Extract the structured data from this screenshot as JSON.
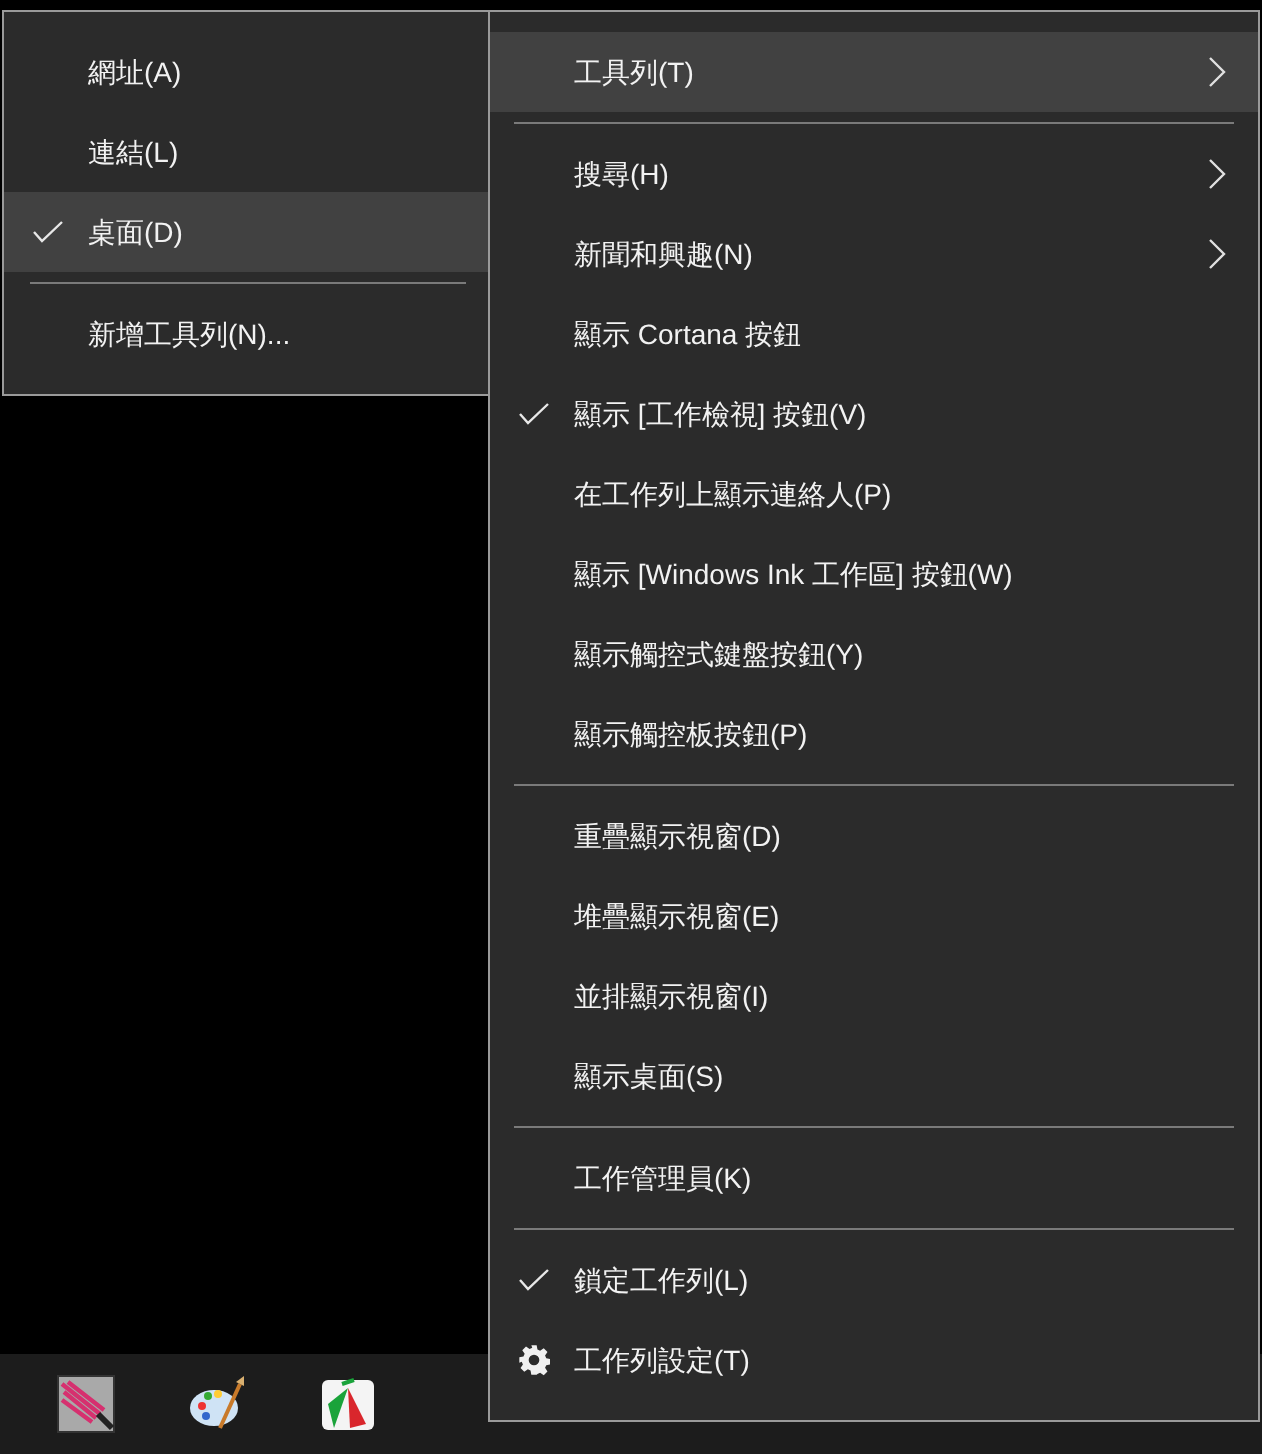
{
  "toolbars_menu": {
    "items": [
      {
        "kind": "item",
        "label": "網址(A)",
        "checked": false,
        "selected": false
      },
      {
        "kind": "item",
        "label": "連結(L)",
        "checked": false,
        "selected": false
      },
      {
        "kind": "item",
        "label": "桌面(D)",
        "checked": true,
        "selected": true
      },
      {
        "kind": "separator"
      },
      {
        "kind": "item",
        "label": "新增工具列(N)...",
        "checked": false,
        "selected": false
      }
    ]
  },
  "context_menu": {
    "items": [
      {
        "kind": "item",
        "label": "工具列(T)",
        "checked": false,
        "selected": true,
        "submenu": true
      },
      {
        "kind": "separator"
      },
      {
        "kind": "item",
        "label": "搜尋(H)",
        "checked": false,
        "selected": false,
        "submenu": true
      },
      {
        "kind": "item",
        "label": "新聞和興趣(N)",
        "checked": false,
        "selected": false,
        "submenu": true
      },
      {
        "kind": "item",
        "label": "顯示 Cortana 按鈕",
        "checked": false,
        "selected": false,
        "submenu": false
      },
      {
        "kind": "item",
        "label": "顯示 [工作檢視] 按鈕(V)",
        "checked": true,
        "selected": false,
        "submenu": false
      },
      {
        "kind": "item",
        "label": "在工作列上顯示連絡人(P)",
        "checked": false,
        "selected": false,
        "submenu": false
      },
      {
        "kind": "item",
        "label": "顯示 [Windows Ink 工作區] 按鈕(W)",
        "checked": false,
        "selected": false,
        "submenu": false
      },
      {
        "kind": "item",
        "label": "顯示觸控式鍵盤按鈕(Y)",
        "checked": false,
        "selected": false,
        "submenu": false
      },
      {
        "kind": "item",
        "label": "顯示觸控板按鈕(P)",
        "checked": false,
        "selected": false,
        "submenu": false
      },
      {
        "kind": "separator"
      },
      {
        "kind": "item",
        "label": "重疊顯示視窗(D)",
        "checked": false,
        "selected": false,
        "submenu": false
      },
      {
        "kind": "item",
        "label": "堆疊顯示視窗(E)",
        "checked": false,
        "selected": false,
        "submenu": false
      },
      {
        "kind": "item",
        "label": "並排顯示視窗(I)",
        "checked": false,
        "selected": false,
        "submenu": false
      },
      {
        "kind": "item",
        "label": "顯示桌面(S)",
        "checked": false,
        "selected": false,
        "submenu": false
      },
      {
        "kind": "separator"
      },
      {
        "kind": "item",
        "label": "工作管理員(K)",
        "checked": false,
        "selected": false,
        "submenu": false
      },
      {
        "kind": "separator"
      },
      {
        "kind": "item",
        "label": "鎖定工作列(L)",
        "checked": true,
        "selected": false,
        "submenu": false
      },
      {
        "kind": "settings",
        "label": "工作列設定(T)",
        "checked": false,
        "selected": false,
        "submenu": false
      }
    ]
  }
}
